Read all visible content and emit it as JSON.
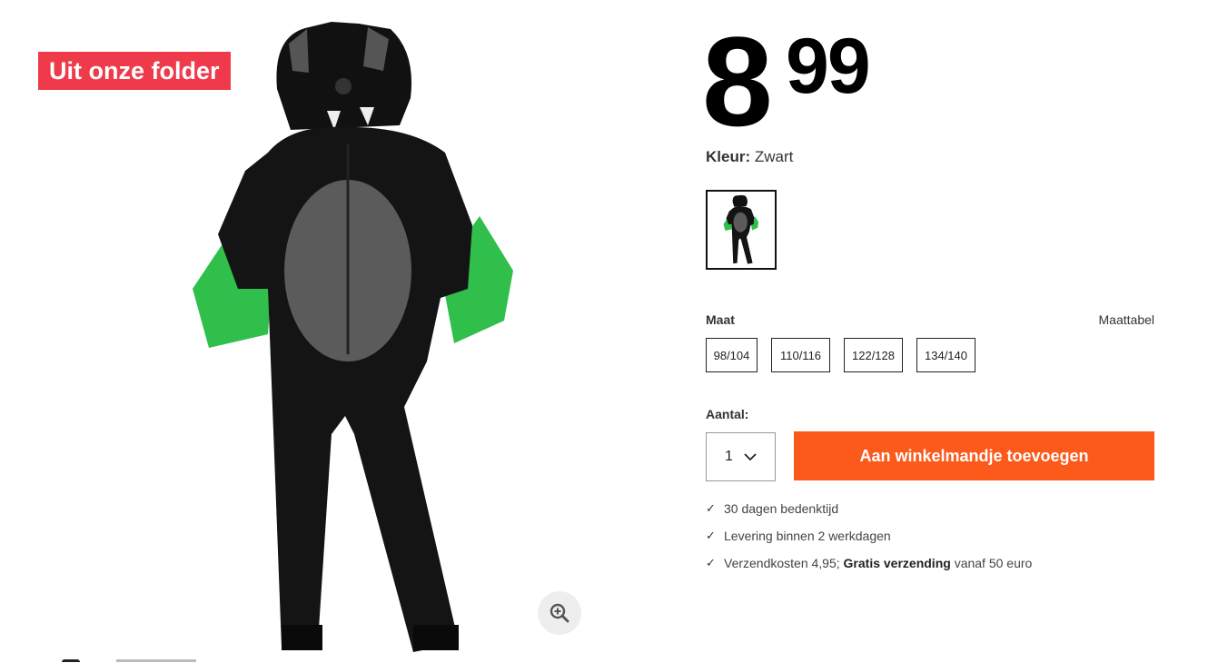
{
  "badge": {
    "label": "Uit onze folder",
    "color": "#ee3a4a"
  },
  "product": {
    "image_alt": "vleermuis onesie kinderen",
    "price": {
      "euros": "8",
      "cents": "99"
    },
    "color": {
      "label": "Kleur:",
      "value": "Zwart"
    },
    "zoom_icon": "zoom-in-icon"
  },
  "sizes": {
    "label": "Maat",
    "chart_link": "Maattabel",
    "options": [
      "98/104",
      "110/116",
      "122/128",
      "134/140"
    ]
  },
  "quantity": {
    "label": "Aantal:",
    "value": "1",
    "icon": "chevron-down-icon"
  },
  "cart_button": {
    "label": "Aan winkelmandje toevoegen",
    "color": "#fc5a1b"
  },
  "usps": [
    {
      "text": "30 dagen bedenktijd"
    },
    {
      "text": "Levering binnen 2 werkdagen"
    },
    {
      "prefix": "Verzendkosten 4,95; ",
      "bold": "Gratis verzending",
      "suffix": " vanaf 50 euro"
    }
  ],
  "check_glyph": "✓"
}
